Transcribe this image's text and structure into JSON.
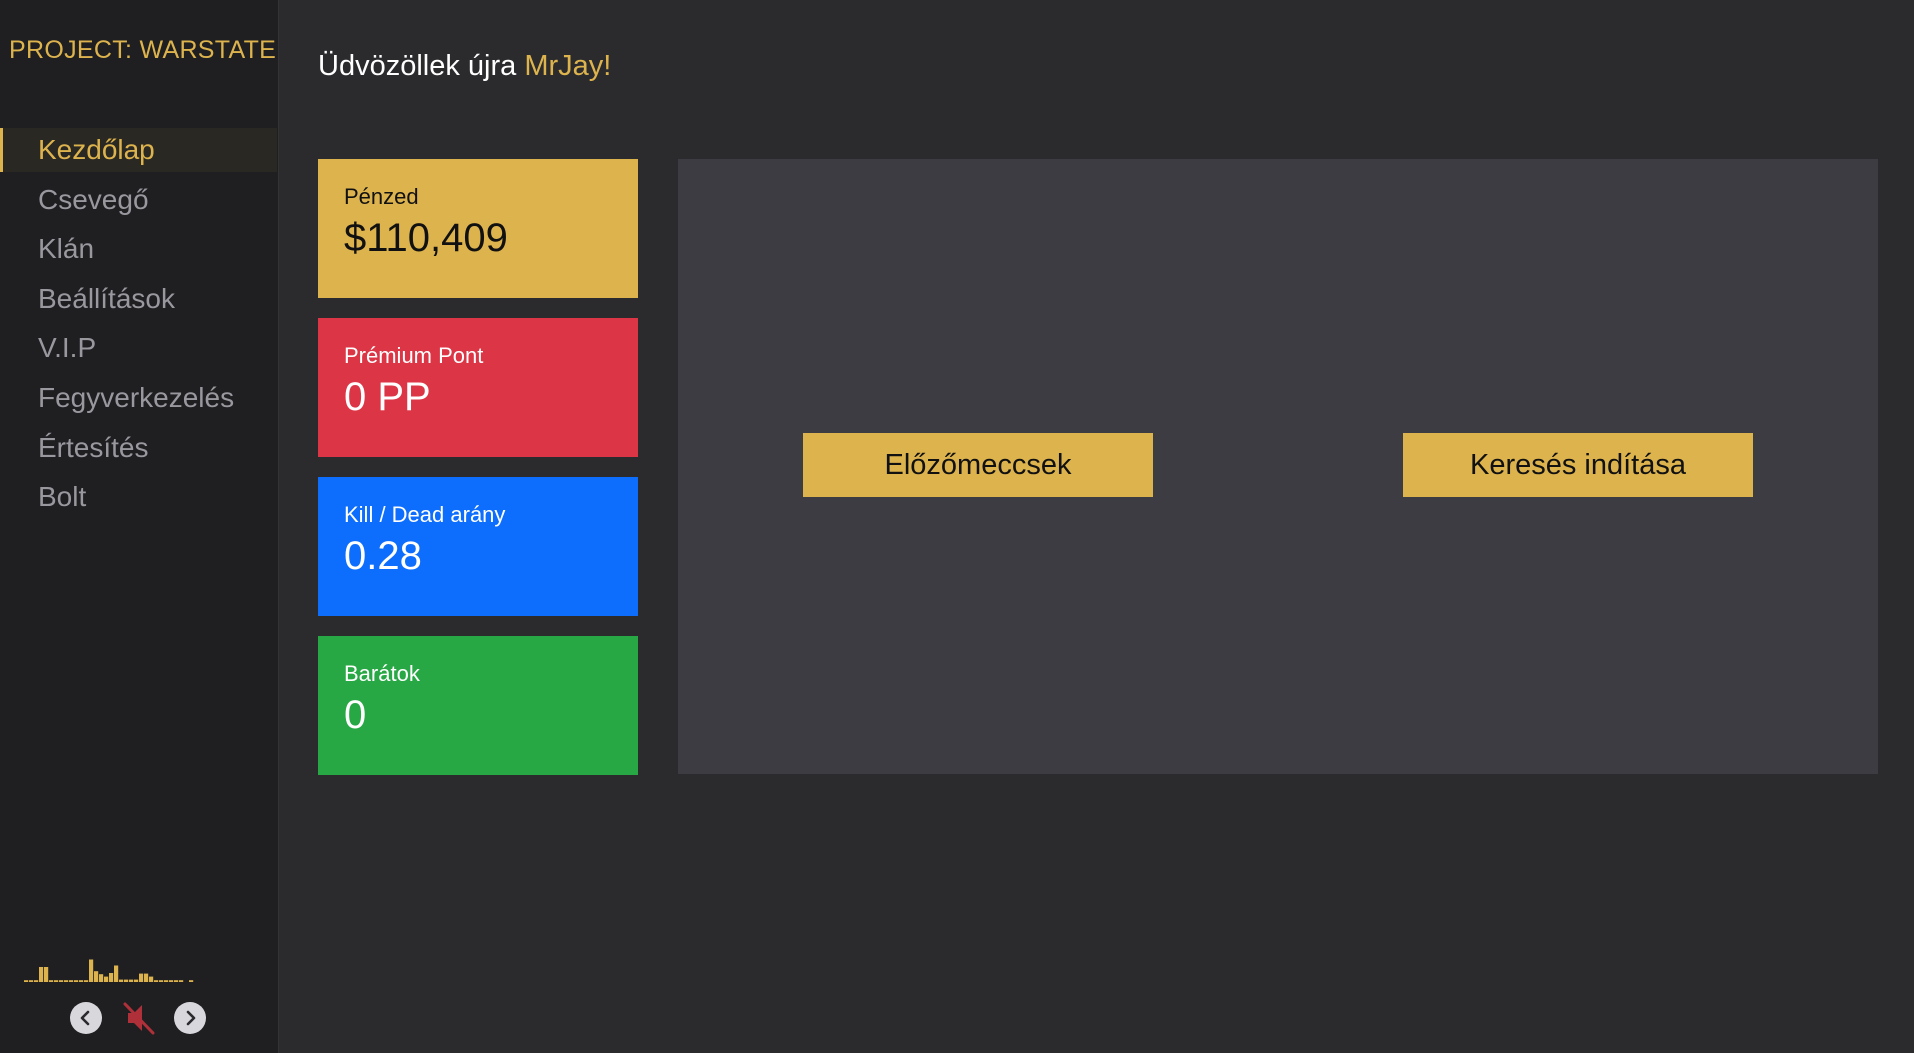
{
  "brand": "PROJECT: WARSTATE",
  "nav": {
    "items": [
      {
        "label": "Kezdőlap",
        "active": true
      },
      {
        "label": "Csevegő",
        "active": false
      },
      {
        "label": "Klán",
        "active": false
      },
      {
        "label": "Beállítások",
        "active": false
      },
      {
        "label": "V.I.P",
        "active": false
      },
      {
        "label": "Fegyverkezelés",
        "active": false
      },
      {
        "label": "Értesítés",
        "active": false
      },
      {
        "label": "Bolt",
        "active": false
      }
    ]
  },
  "greeting": {
    "prefix": "Üdvözöllek újra ",
    "username": "MrJay!"
  },
  "stats": {
    "money": {
      "label": "Pénzed",
      "value": "$110,409",
      "color": "#ddb34e"
    },
    "premium": {
      "label": "Prémium Pont",
      "value": "0 PP",
      "color": "#dc3545"
    },
    "kd": {
      "label": "Kill / Dead arány",
      "value": "0.28",
      "color": "#0d6efd"
    },
    "friends": {
      "label": "Barátok",
      "value": "0",
      "color": "#28a745"
    }
  },
  "actions": {
    "history_label": "Előzőmeccsek",
    "search_label": "Keresés indítása"
  },
  "player": {
    "prev_icon": "chevron-left-icon",
    "mute_icon": "speaker-muted-icon",
    "next_icon": "chevron-right-icon",
    "muted": true,
    "visualizer_levels": [
      0.06,
      0.06,
      0.06,
      0.5,
      0.5,
      0.06,
      0.06,
      0.06,
      0.06,
      0.06,
      0.06,
      0.06,
      0.06,
      0.75,
      0.36,
      0.26,
      0.18,
      0.3,
      0.55,
      0.08,
      0.08,
      0.08,
      0.08,
      0.28,
      0.28,
      0.18,
      0.06,
      0.06,
      0.06,
      0.06,
      0.06,
      0.06,
      0.0,
      0.06
    ],
    "accent": "#ddb34e",
    "mute_color": "#b0303a"
  }
}
